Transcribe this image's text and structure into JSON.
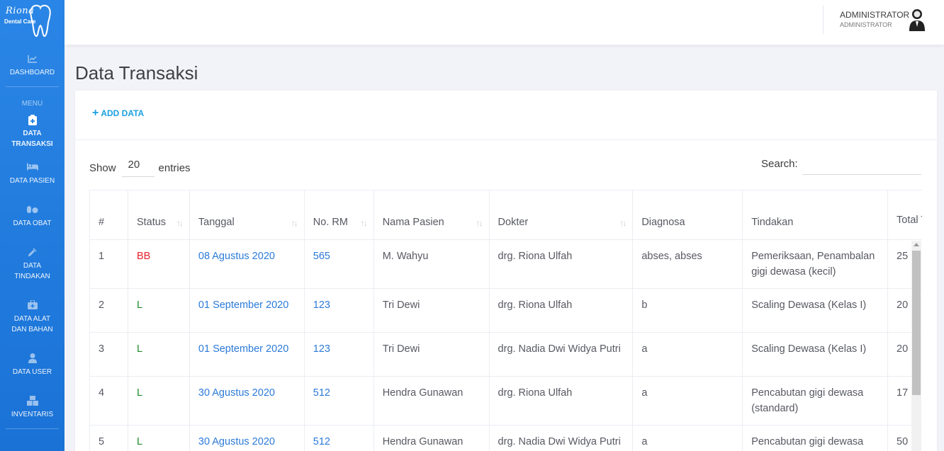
{
  "brand": {
    "name": "Riona",
    "subtitle": "Dental Care"
  },
  "sidebar": {
    "items_top": [
      {
        "label": "DASHBOARD",
        "icon": "chart-icon"
      }
    ],
    "menu_label": "MENU",
    "items": [
      {
        "label_line1": "DATA",
        "label_line2": "TRANSAKSI",
        "icon": "clipboard-icon",
        "active": true
      },
      {
        "label_line1": "DATA PASIEN",
        "label_line2": "",
        "icon": "bed-icon"
      },
      {
        "label_line1": "DATA OBAT",
        "label_line2": "",
        "icon": "pills-icon"
      },
      {
        "label_line1": "DATA",
        "label_line2": "TINDAKAN",
        "icon": "syringe-icon"
      },
      {
        "label_line1": "DATA ALAT",
        "label_line2": "DAN BAHAN",
        "icon": "medkit-icon"
      },
      {
        "label_line1": "DATA USER",
        "label_line2": "",
        "icon": "user-icon"
      },
      {
        "label_line1": "INVENTARIS",
        "label_line2": "",
        "icon": "boxes-icon"
      }
    ]
  },
  "header": {
    "user_name": "ADMINISTRATOR",
    "user_role": "ADMINISTRATOR"
  },
  "page": {
    "title": "Data Transaksi"
  },
  "card": {
    "add_label": "ADD DATA",
    "show_label": "Show",
    "show_value": "20",
    "entries_label": "entries",
    "search_label": "Search:",
    "search_placeholder": ""
  },
  "table": {
    "columns": [
      "#",
      "Status",
      "Tanggal",
      "No. RM",
      "Nama Pasien",
      "Dokter",
      "Diagnosa",
      "Tindakan",
      "Total Tinda"
    ],
    "rows": [
      {
        "no": "1",
        "status": "BB",
        "tanggal": "08 Agustus 2020",
        "rm": "565",
        "nama": "M. Wahyu",
        "dokter": "drg. Riona Ulfah",
        "diagnosa": "abses, abses",
        "tindakan": "Pemeriksaan, Penambalan gigi dewasa (kecil)",
        "total": "25"
      },
      {
        "no": "2",
        "status": "L",
        "tanggal": "01 September 2020",
        "rm": "123",
        "nama": "Tri Dewi",
        "dokter": "drg. Riona Ulfah",
        "diagnosa": "b",
        "tindakan": "Scaling Dewasa (Kelas I)",
        "total": "20"
      },
      {
        "no": "3",
        "status": "L",
        "tanggal": "01 September 2020",
        "rm": "123",
        "nama": "Tri Dewi",
        "dokter": "drg. Nadia Dwi Widya Putri",
        "diagnosa": "a",
        "tindakan": "Scaling Dewasa (Kelas I)",
        "total": "20"
      },
      {
        "no": "4",
        "status": "L",
        "tanggal": "30 Agustus 2020",
        "rm": "512",
        "nama": "Hendra Gunawan",
        "dokter": "drg. Riona Ulfah",
        "diagnosa": "a",
        "tindakan": "Pencabutan gigi dewasa (standard)",
        "total": "17"
      },
      {
        "no": "5",
        "status": "L",
        "tanggal": "30 Agustus 2020",
        "rm": "512",
        "nama": "Hendra Gunawan",
        "dokter": "drg. Nadia Dwi Widya Putri",
        "diagnosa": "a",
        "tindakan": "Pencabutan gigi dewasa",
        "total": "50"
      }
    ]
  },
  "colors": {
    "sidebar": "#1f7fe0",
    "link": "#2b7ad8",
    "status_bb": "#e5202b",
    "status_l": "#1f8a2a",
    "accent": "#1a9fe0"
  }
}
